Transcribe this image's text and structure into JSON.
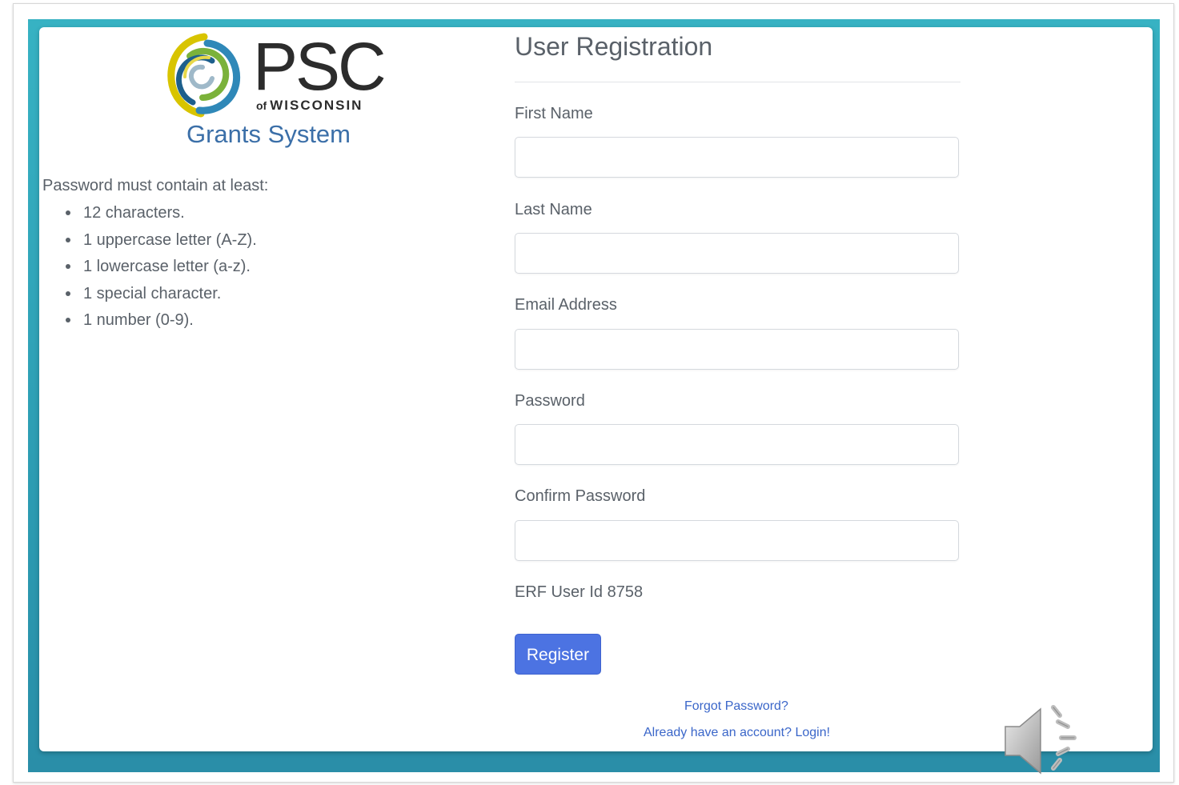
{
  "logo": {
    "brand": "PSC",
    "of_text": "of",
    "state": "WISCONSIN",
    "subtitle": "Grants System"
  },
  "password_rules": {
    "heading": "Password must contain at least:",
    "items": [
      "12 characters.",
      "1 uppercase letter (A-Z).",
      "1 lowercase letter (a-z).",
      "1 special character.",
      "1 number (0-9)."
    ]
  },
  "form": {
    "title": "User Registration",
    "fields": [
      {
        "label": "First Name",
        "value": ""
      },
      {
        "label": "Last Name",
        "value": ""
      },
      {
        "label": "Email Address",
        "value": ""
      },
      {
        "label": "Password",
        "value": ""
      },
      {
        "label": "Confirm Password",
        "value": ""
      }
    ],
    "erf_user_id": "ERF User Id 8758",
    "register_label": "Register",
    "forgot_password": "Forgot Password?",
    "login_link": "Already have an account? Login!"
  },
  "icons": {
    "audio": "speaker-icon"
  },
  "colors": {
    "teal": "#37b2c3",
    "button": "#4c73e2",
    "link": "#3a66c9",
    "grants_title": "#3b6fa8"
  }
}
